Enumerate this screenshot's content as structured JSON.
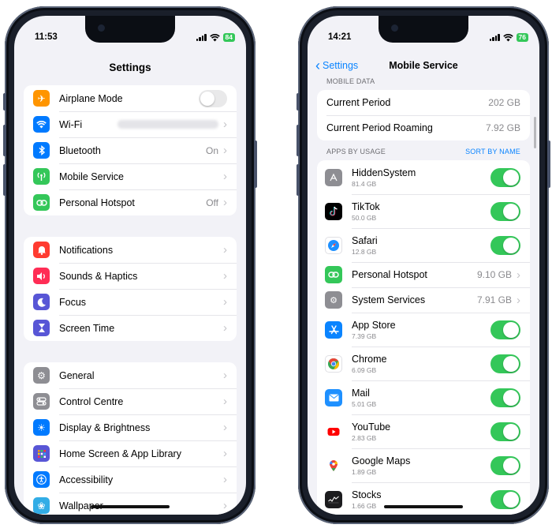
{
  "left_phone": {
    "status": {
      "time": "11:53",
      "battery": "84"
    },
    "title": "Settings",
    "groups": [
      [
        {
          "label": "Airplane Mode",
          "icon": "airplane-icon",
          "color": "#ff9500",
          "accessory": "toggle-off"
        },
        {
          "label": "Wi-Fi",
          "icon": "wifi-icon",
          "color": "#007aff",
          "accessory": "blurred"
        },
        {
          "label": "Bluetooth",
          "icon": "bluetooth-icon",
          "color": "#007aff",
          "value": "On"
        },
        {
          "label": "Mobile Service",
          "icon": "antenna-icon",
          "color": "#34c759"
        },
        {
          "label": "Personal Hotspot",
          "icon": "hotspot-icon",
          "color": "#34c759",
          "value": "Off"
        }
      ],
      [
        {
          "label": "Notifications",
          "icon": "bell-icon",
          "color": "#ff3b30"
        },
        {
          "label": "Sounds & Haptics",
          "icon": "speaker-icon",
          "color": "#ff2d55"
        },
        {
          "label": "Focus",
          "icon": "moon-icon",
          "color": "#5856d6"
        },
        {
          "label": "Screen Time",
          "icon": "hourglass-icon",
          "color": "#5856d6"
        }
      ],
      [
        {
          "label": "General",
          "icon": "gear-icon",
          "color": "#8e8e93"
        },
        {
          "label": "Control Centre",
          "icon": "switches-icon",
          "color": "#8e8e93"
        },
        {
          "label": "Display & Brightness",
          "icon": "sun-icon",
          "color": "#007aff"
        },
        {
          "label": "Home Screen & App Library",
          "icon": "grid-icon",
          "color": "#5856d6"
        },
        {
          "label": "Accessibility",
          "icon": "accessibility-icon",
          "color": "#007aff"
        },
        {
          "label": "Wallpaper",
          "icon": "flower-icon",
          "color": "#32ade6"
        }
      ]
    ]
  },
  "right_phone": {
    "status": {
      "time": "14:21",
      "battery": "76"
    },
    "back_label": "Settings",
    "title": "Mobile Service",
    "section_mobile_data": "MOBILE DATA",
    "data_rows": [
      {
        "label": "Current Period",
        "value": "202 GB"
      },
      {
        "label": "Current Period Roaming",
        "value": "7.92 GB"
      }
    ],
    "section_apps": "APPS BY USAGE",
    "sort_label": "SORT BY NAME",
    "apps": [
      {
        "name": "HiddenSystem",
        "size": "81.4 GB",
        "icon": "app-placeholder-icon",
        "color": "#8e8e93",
        "type": "toggle"
      },
      {
        "name": "TikTok",
        "size": "50.0 GB",
        "icon": "tiktok-icon",
        "color": "#000000",
        "type": "toggle"
      },
      {
        "name": "Safari",
        "size": "12.8 GB",
        "icon": "compass-icon",
        "color": "#0a84ff",
        "type": "toggle"
      },
      {
        "name": "Personal Hotspot",
        "value": "9.10 GB",
        "icon": "hotspot-icon",
        "color": "#34c759",
        "type": "chevron"
      },
      {
        "name": "System Services",
        "value": "7.91 GB",
        "icon": "gear-icon",
        "color": "#8e8e93",
        "type": "chevron"
      },
      {
        "name": "App Store",
        "size": "7.39 GB",
        "icon": "appstore-icon",
        "color": "#0a84ff",
        "type": "toggle"
      },
      {
        "name": "Chrome",
        "size": "6.09 GB",
        "icon": "chrome-icon",
        "color": "#ffffff",
        "type": "toggle"
      },
      {
        "name": "Mail",
        "size": "5.01 GB",
        "icon": "mail-icon",
        "color": "#1e90ff",
        "type": "toggle"
      },
      {
        "name": "YouTube",
        "size": "2.83 GB",
        "icon": "youtube-icon",
        "color": "#ffffff",
        "type": "toggle"
      },
      {
        "name": "Google Maps",
        "size": "1.89 GB",
        "icon": "map-pin-icon",
        "color": "#ffffff",
        "type": "toggle"
      },
      {
        "name": "Stocks",
        "size": "1.66 GB",
        "icon": "stocks-icon",
        "color": "#1c1c1e",
        "type": "toggle"
      }
    ]
  }
}
